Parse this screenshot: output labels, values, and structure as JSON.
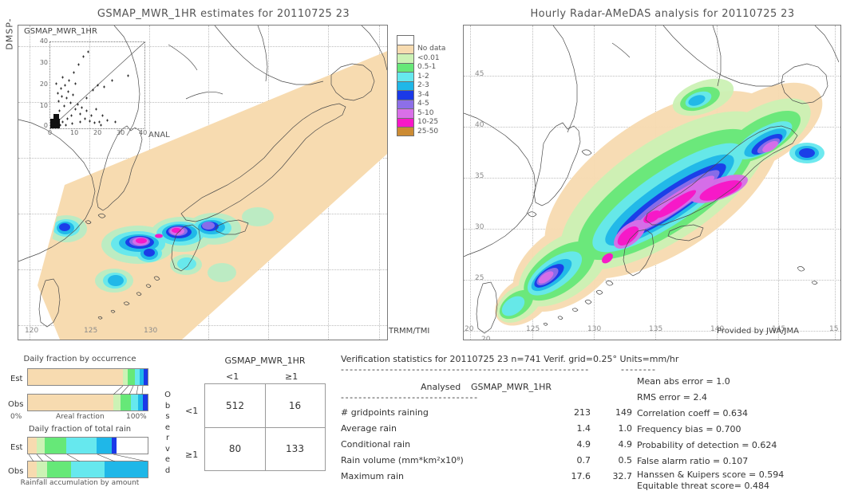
{
  "meta": {
    "sensor_label": "DMSP-",
    "left_panel_title": "GSMAP_MWR_1HR estimates for 20110725 23",
    "right_panel_title": "Hourly Radar-AMeDAS analysis for 20110725 23",
    "left_corner_label": "TRMM/TMI",
    "right_corner_label": "Provided by JWA/JMA"
  },
  "scatter": {
    "title": "GSMAP_MWR_1HR",
    "x_label": "ANAL",
    "y_ticks": [
      "40",
      "30",
      "20",
      "10",
      "0"
    ],
    "x_ticks": [
      "0",
      "10",
      "20",
      "30",
      "40"
    ]
  },
  "legend": {
    "entries": [
      {
        "label": "No data",
        "color": "#f7dbb0"
      },
      {
        "label": "<0.01",
        "color": "#ccf2b5"
      },
      {
        "label": "0.5-1",
        "color": "#66e878"
      },
      {
        "label": "1-2",
        "color": "#66e8ee"
      },
      {
        "label": "2-3",
        "color": "#1fb7e8"
      },
      {
        "label": "3-4",
        "color": "#1b39e8"
      },
      {
        "label": "4-5",
        "color": "#8d6fe8"
      },
      {
        "label": "5-10",
        "color": "#d96fe8"
      },
      {
        "label": "10-25",
        "color": "#f718c8"
      },
      {
        "label": "25-50",
        "color": "#cc8b33"
      }
    ],
    "top_blank_color": "#ffffff"
  },
  "map_axes": {
    "lon_ticks": [
      "120",
      "125",
      "130",
      "135",
      "140",
      "145",
      "15"
    ],
    "lat_ticks": [
      "45",
      "40",
      "35",
      "30",
      "25",
      "20"
    ],
    "lat_extra_bottom": "20"
  },
  "occurrence_chart": {
    "title": "Daily fraction by occurrence",
    "x_label": "Areal fraction",
    "x_min_label": "0%",
    "x_max_label": "100%",
    "rows": [
      {
        "label": "Est",
        "segments": [
          {
            "color": "#f7dbb0",
            "pct": 79.0
          },
          {
            "color": "#ccf2b5",
            "pct": 4.5
          },
          {
            "color": "#66e878",
            "pct": 6.0
          },
          {
            "color": "#66e8ee",
            "pct": 4.0
          },
          {
            "color": "#1fb7e8",
            "pct": 3.0
          },
          {
            "color": "#1b39e8",
            "pct": 3.5
          }
        ]
      },
      {
        "label": "Obs",
        "segments": [
          {
            "color": "#f7dbb0",
            "pct": 71.0
          },
          {
            "color": "#ccf2b5",
            "pct": 6.0
          },
          {
            "color": "#66e878",
            "pct": 9.0
          },
          {
            "color": "#66e8ee",
            "pct": 6.0
          },
          {
            "color": "#1fb7e8",
            "pct": 4.0
          },
          {
            "color": "#1b39e8",
            "pct": 4.0
          }
        ]
      }
    ]
  },
  "totalrain_chart": {
    "title": "Daily fraction of total rain",
    "x_label": "Rainfall accumulation by amount",
    "rows": [
      {
        "label": "Est",
        "segments": [
          {
            "color": "#f7dbb0",
            "pct": 7.0
          },
          {
            "color": "#ccf2b5",
            "pct": 7.0
          },
          {
            "color": "#66e878",
            "pct": 18.0
          },
          {
            "color": "#66e8ee",
            "pct": 25.0
          },
          {
            "color": "#1fb7e8",
            "pct": 13.0
          },
          {
            "color": "#1b39e8",
            "pct": 4.0
          }
        ]
      },
      {
        "label": "Obs",
        "segments": [
          {
            "color": "#f7dbb0",
            "pct": 7.0
          },
          {
            "color": "#ccf2b5",
            "pct": 9.0
          },
          {
            "color": "#66e878",
            "pct": 20.0
          },
          {
            "color": "#66e8ee",
            "pct": 28.0
          },
          {
            "color": "#1fb7e8",
            "pct": 36.0
          }
        ]
      }
    ]
  },
  "contingency": {
    "title": "GSMAP_MWR_1HR",
    "col_headers": [
      "<1",
      "≥1"
    ],
    "row_headers": [
      "<1",
      "≥1"
    ],
    "row_axis_label": "Observed",
    "cells": [
      [
        "512",
        "16"
      ],
      [
        "80",
        "133"
      ]
    ]
  },
  "stats": {
    "header": "Verification statistics for 20110725 23  n=741  Verif. grid=0.25°  Units=mm/hr",
    "divider": "--------------------------------------------------------",
    "table_header_analysed": "Analysed",
    "table_header_model": "GSMAP_MWR_1HR",
    "table_divider": "-------------------------------",
    "rows": [
      {
        "name": "# gridpoints raining",
        "analysed": "213",
        "model": "149"
      },
      {
        "name": "Average rain",
        "analysed": "1.4",
        "model": "1.0"
      },
      {
        "name": "Conditional rain",
        "analysed": "4.9",
        "model": "4.9"
      },
      {
        "name": "Rain volume (mm*km²x10⁸)",
        "analysed": "0.7",
        "model": "0.5"
      },
      {
        "name": "Maximum rain",
        "analysed": "17.6",
        "model": "32.7"
      }
    ],
    "scores_divider": "--------",
    "scores": [
      "Mean abs error = 1.0",
      "RMS error = 2.4",
      "Correlation coeff = 0.634",
      "Frequency bias = 0.700",
      "Probability of detection = 0.624",
      "False alarm ratio = 0.107",
      "Hanssen & Kuipers score = 0.594",
      "Equitable threat score= 0.484"
    ]
  },
  "chart_data": {
    "type": "table",
    "title": "Verification statistics for 20110725 23",
    "n": 741,
    "verif_grid_deg": 0.25,
    "units": "mm/hr",
    "columns": [
      "",
      "Analysed",
      "GSMAP_MWR_1HR"
    ],
    "rows": [
      [
        "# gridpoints raining",
        213,
        149
      ],
      [
        "Average rain",
        1.4,
        1.0
      ],
      [
        "Conditional rain",
        4.9,
        4.9
      ],
      [
        "Rain volume (mm*km^2x10^8)",
        0.7,
        0.5
      ],
      [
        "Maximum rain",
        17.6,
        32.7
      ]
    ],
    "contingency_table": {
      "row_axis": "Observed",
      "col_axis": "GSMAP_MWR_1HR",
      "categories": [
        "<1",
        ">=1"
      ],
      "matrix": [
        [
          512,
          16
        ],
        [
          80,
          133
        ]
      ]
    },
    "scores": {
      "mean_abs_error": 1.0,
      "rms_error": 2.4,
      "correlation_coeff": 0.634,
      "frequency_bias": 0.7,
      "probability_of_detection": 0.624,
      "false_alarm_ratio": 0.107,
      "hanssen_kuipers_score": 0.594,
      "equitable_threat_score": 0.484
    },
    "legend_bins_mm_per_hr": [
      "No data",
      "<0.01",
      "0.5-1",
      "1-2",
      "2-3",
      "3-4",
      "4-5",
      "5-10",
      "10-25",
      "25-50"
    ],
    "map_lon_range": [
      119,
      150
    ],
    "map_lat_range": [
      19,
      47
    ]
  }
}
